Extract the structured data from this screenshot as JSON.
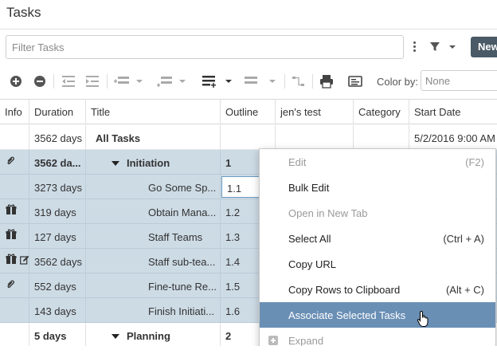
{
  "app": {
    "title": "Tasks"
  },
  "filter": {
    "placeholder": "Filter Tasks"
  },
  "toolbar": {
    "new_label": "New",
    "color_by_label": "Color by:",
    "color_by_value": "None",
    "icons": [
      "add-icon",
      "remove-icon",
      "outdent-icon",
      "indent-icon",
      "insert-row-above-icon",
      "insert-row-below-icon",
      "insert-row-icon",
      "delete-row-icon",
      "dependency-icon",
      "print-icon",
      "card-view-icon"
    ]
  },
  "grid": {
    "columns": [
      "Info",
      "Duration",
      "Title",
      "Outline",
      "jen's test",
      "Category",
      "Start Date"
    ],
    "rows": [
      {
        "info": [],
        "duration": "3562 days",
        "title": "All Tasks",
        "outline": "",
        "start": "5/2/2016 9:00 AM",
        "selected": false,
        "bold": true,
        "caret": false
      },
      {
        "info": [
          "paperclip-icon"
        ],
        "duration": "3562 da...",
        "title": "Initiation",
        "outline": "1",
        "start": "",
        "selected": true,
        "bold": true,
        "caret": true
      },
      {
        "info": [],
        "duration": "3273 days",
        "title": "Go Some Sp...",
        "outline": "1.1",
        "start": "",
        "selected": true,
        "bold": false,
        "caret": false
      },
      {
        "info": [
          "gift-icon"
        ],
        "duration": "319 days",
        "title": "Obtain Mana...",
        "outline": "1.2",
        "start": "",
        "selected": true,
        "bold": false,
        "caret": false
      },
      {
        "info": [
          "gift-icon"
        ],
        "duration": "127 days",
        "title": "Staff Teams",
        "outline": "1.3",
        "start": "",
        "selected": true,
        "bold": false,
        "caret": false
      },
      {
        "info": [
          "gift-icon",
          "edit-icon"
        ],
        "duration": "3562 days",
        "title": "Staff sub-tea...",
        "outline": "1.4",
        "start": "",
        "selected": true,
        "bold": false,
        "caret": false
      },
      {
        "info": [
          "paperclip-icon"
        ],
        "duration": "552 days",
        "title": "Fine-tune Re...",
        "outline": "1.5",
        "start": "",
        "selected": true,
        "bold": false,
        "caret": false
      },
      {
        "info": [],
        "duration": "143 days",
        "title": "Finish Initiati...",
        "outline": "1.6",
        "start": "",
        "selected": true,
        "bold": false,
        "caret": false
      },
      {
        "info": [],
        "duration": "5 days",
        "title": "Planning",
        "outline": "2",
        "start": "",
        "selected": false,
        "bold": true,
        "caret": true
      }
    ]
  },
  "context_menu": {
    "items": [
      {
        "label": "Edit",
        "shortcut": "(F2)",
        "disabled": true
      },
      {
        "label": "Bulk Edit",
        "shortcut": "",
        "disabled": false
      },
      {
        "label": "Open in New Tab",
        "shortcut": "",
        "disabled": true
      },
      {
        "label": "Select All",
        "shortcut": "(Ctrl + A)",
        "disabled": false
      },
      {
        "label": "Copy URL",
        "shortcut": "",
        "disabled": false
      },
      {
        "label": "Copy Rows to Clipboard",
        "shortcut": "(Alt + C)",
        "disabled": false
      },
      {
        "label": "Associate Selected Tasks",
        "shortcut": "",
        "highlighted": true
      },
      {
        "label": "Expand",
        "shortcut": "",
        "disabled": true
      }
    ]
  },
  "colors": {
    "selection": "#cddbe5",
    "menu_highlight": "#6a8fb5",
    "new_button": "#4a5a66"
  }
}
